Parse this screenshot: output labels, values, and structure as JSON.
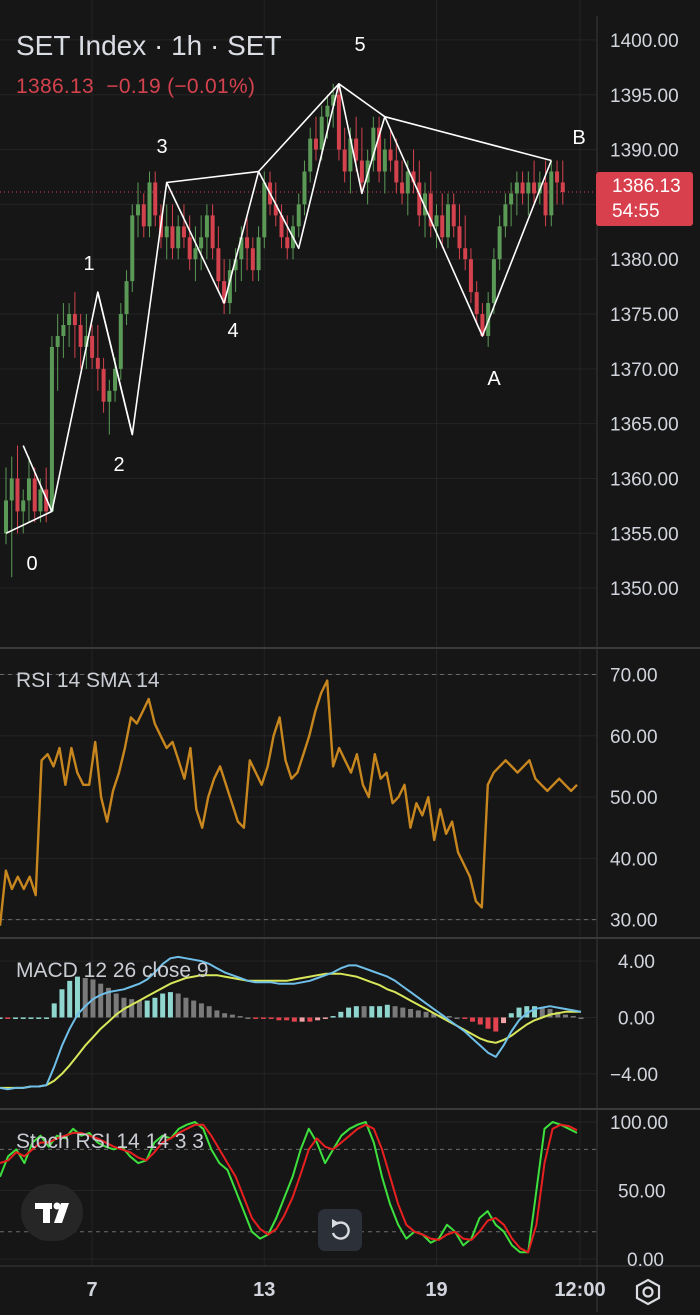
{
  "header": {
    "title": "SET Index · 1h · SET",
    "price": "1386.13",
    "change": "−0.19",
    "change_pct": "(−0.01%)"
  },
  "badge": {
    "price": "1386.13",
    "countdown": "54:55"
  },
  "indicators": {
    "rsi": "RSI 14 SMA 14",
    "macd": "MACD 12 26 close 9",
    "stoch": "Stoch RSI 14 14 3 3"
  },
  "colors": {
    "background": "#161616",
    "up": "#5b9a56",
    "down": "#d4424e",
    "rsi": "#c8861f",
    "macd": "#6fbfe8",
    "signal": "#d9e85a",
    "stoch_k": "#3ee03e",
    "stoch_d": "#e82020",
    "wave_lines": "#ffffff"
  },
  "chart_data": [
    {
      "type": "candlestick",
      "title": "SET Index · 1h · SET",
      "y_ticks": [
        "1400.00",
        "1395.00",
        "1390.00",
        "1385.00",
        "1380.00",
        "1375.00",
        "1370.00",
        "1365.00",
        "1360.00",
        "1355.00",
        "1350.00"
      ],
      "ylim": [
        1346,
        1402
      ],
      "x_ticks": [
        {
          "label": "7",
          "i": 15
        },
        {
          "label": "13",
          "i": 45
        },
        {
          "label": "19",
          "i": 75
        },
        {
          "label": "12:00",
          "i": 100
        }
      ],
      "last_price": 1386.13,
      "candles": [
        [
          1355,
          1361,
          1354,
          1358
        ],
        [
          1358,
          1362,
          1351,
          1360
        ],
        [
          1360,
          1363,
          1355,
          1357
        ],
        [
          1357,
          1359,
          1355,
          1358
        ],
        [
          1358,
          1362,
          1356,
          1360
        ],
        [
          1360,
          1361,
          1356,
          1357
        ],
        [
          1357,
          1360,
          1356,
          1359
        ],
        [
          1359,
          1361,
          1356,
          1357
        ],
        [
          1357,
          1373,
          1357,
          1372
        ],
        [
          1372,
          1375,
          1368,
          1373
        ],
        [
          1373,
          1376,
          1371,
          1374
        ],
        [
          1374,
          1376,
          1372,
          1375
        ],
        [
          1375,
          1377,
          1371,
          1374
        ],
        [
          1374,
          1375,
          1370,
          1372
        ],
        [
          1372,
          1375,
          1370,
          1373
        ],
        [
          1373,
          1374,
          1370,
          1371
        ],
        [
          1371,
          1374,
          1368,
          1370
        ],
        [
          1370,
          1371,
          1366,
          1367
        ],
        [
          1367,
          1369,
          1364,
          1368
        ],
        [
          1368,
          1371,
          1367,
          1370
        ],
        [
          1370,
          1376,
          1369,
          1375
        ],
        [
          1375,
          1379,
          1374,
          1378
        ],
        [
          1378,
          1385,
          1377,
          1384
        ],
        [
          1384,
          1387,
          1382,
          1385
        ],
        [
          1385,
          1386,
          1382,
          1383
        ],
        [
          1383,
          1388,
          1382,
          1387
        ],
        [
          1387,
          1388,
          1383,
          1384
        ],
        [
          1384,
          1385,
          1381,
          1382
        ],
        [
          1382,
          1385,
          1380,
          1383
        ],
        [
          1383,
          1385,
          1380,
          1381
        ],
        [
          1381,
          1384,
          1380,
          1383
        ],
        [
          1383,
          1385,
          1381,
          1382
        ],
        [
          1382,
          1384,
          1379,
          1380
        ],
        [
          1380,
          1383,
          1378,
          1381
        ],
        [
          1381,
          1384,
          1379,
          1382
        ],
        [
          1382,
          1385,
          1380,
          1384
        ],
        [
          1384,
          1385,
          1380,
          1381
        ],
        [
          1381,
          1383,
          1377,
          1378
        ],
        [
          1378,
          1380,
          1375,
          1376
        ],
        [
          1376,
          1380,
          1375,
          1379
        ],
        [
          1379,
          1381,
          1377,
          1380
        ],
        [
          1380,
          1383,
          1378,
          1382
        ],
        [
          1382,
          1384,
          1379,
          1381
        ],
        [
          1381,
          1382,
          1378,
          1379
        ],
        [
          1379,
          1383,
          1378,
          1382
        ],
        [
          1382,
          1388,
          1381,
          1387
        ],
        [
          1387,
          1388,
          1384,
          1385
        ],
        [
          1385,
          1387,
          1383,
          1384
        ],
        [
          1384,
          1385,
          1381,
          1382
        ],
        [
          1382,
          1384,
          1380,
          1381
        ],
        [
          1381,
          1384,
          1380,
          1383
        ],
        [
          1383,
          1386,
          1382,
          1385
        ],
        [
          1385,
          1389,
          1384,
          1388
        ],
        [
          1388,
          1392,
          1387,
          1391
        ],
        [
          1391,
          1393,
          1389,
          1390
        ],
        [
          1390,
          1394,
          1389,
          1393
        ],
        [
          1393,
          1395,
          1391,
          1394
        ],
        [
          1394,
          1396,
          1392,
          1395
        ],
        [
          1395,
          1396,
          1389,
          1390
        ],
        [
          1390,
          1392,
          1387,
          1388
        ],
        [
          1388,
          1392,
          1386,
          1391
        ],
        [
          1391,
          1393,
          1388,
          1389
        ],
        [
          1389,
          1392,
          1386,
          1387
        ],
        [
          1387,
          1390,
          1385,
          1389
        ],
        [
          1389,
          1393,
          1388,
          1392
        ],
        [
          1392,
          1393,
          1387,
          1388
        ],
        [
          1388,
          1391,
          1386,
          1390
        ],
        [
          1390,
          1392,
          1388,
          1389
        ],
        [
          1389,
          1391,
          1386,
          1387
        ],
        [
          1387,
          1389,
          1385,
          1386
        ],
        [
          1386,
          1389,
          1384,
          1388
        ],
        [
          1388,
          1390,
          1386,
          1387
        ],
        [
          1387,
          1389,
          1383,
          1384
        ],
        [
          1384,
          1387,
          1382,
          1386
        ],
        [
          1386,
          1388,
          1382,
          1383
        ],
        [
          1383,
          1385,
          1381,
          1384
        ],
        [
          1384,
          1386,
          1381,
          1382
        ],
        [
          1382,
          1386,
          1381,
          1385
        ],
        [
          1385,
          1386,
          1382,
          1383
        ],
        [
          1383,
          1385,
          1380,
          1381
        ],
        [
          1381,
          1384,
          1379,
          1380
        ],
        [
          1380,
          1381,
          1376,
          1377
        ],
        [
          1377,
          1378,
          1374,
          1375
        ],
        [
          1375,
          1376,
          1373,
          1373
        ],
        [
          1373,
          1377,
          1372,
          1376
        ],
        [
          1376,
          1381,
          1375,
          1380
        ],
        [
          1380,
          1384,
          1379,
          1383
        ],
        [
          1383,
          1386,
          1382,
          1385
        ],
        [
          1385,
          1387,
          1383,
          1386
        ],
        [
          1386,
          1388,
          1384,
          1387
        ],
        [
          1387,
          1388,
          1385,
          1386
        ],
        [
          1386,
          1388,
          1384,
          1387
        ],
        [
          1387,
          1389,
          1385,
          1386
        ],
        [
          1386,
          1388,
          1385,
          1387
        ],
        [
          1387,
          1389,
          1383,
          1384
        ],
        [
          1384,
          1389,
          1383,
          1388
        ],
        [
          1388,
          1389,
          1385,
          1387
        ],
        [
          1387,
          1389,
          1385,
          1386.13
        ]
      ],
      "wave_labels": [
        "0",
        "1",
        "2",
        "3",
        "4",
        "5",
        "A",
        "B"
      ],
      "wave_lines": [
        {
          "points": [
            [
              0,
              1355
            ],
            [
              8,
              1357
            ],
            [
              16,
              1377
            ],
            [
              22,
              1364
            ],
            [
              28,
              1387
            ],
            [
              38,
              1376
            ],
            [
              44,
              1388
            ],
            [
              51,
              1381
            ],
            [
              58,
              1396
            ],
            [
              62,
              1386
            ],
            [
              66,
              1393
            ],
            [
              83,
              1373
            ],
            [
              95,
              1389
            ]
          ]
        },
        {
          "points": [
            [
              3,
              1363
            ],
            [
              8,
              1357
            ]
          ]
        },
        {
          "points": [
            [
              22,
              1364
            ],
            [
              16,
              1377
            ]
          ]
        },
        {
          "points": [
            [
              28,
              1387
            ],
            [
              44,
              1388
            ],
            [
              58,
              1396
            ],
            [
              66,
              1393
            ],
            [
              95,
              1389
            ]
          ]
        }
      ]
    },
    {
      "type": "line",
      "title": "RSI 14 SMA 14",
      "y_ticks": [
        "70.00",
        "60.00",
        "50.00",
        "40.00",
        "30.00"
      ],
      "ylim": [
        27,
        74
      ],
      "bands": [
        30,
        70
      ],
      "x_count": 98,
      "series": [
        {
          "values": [
            29,
            38,
            35,
            37,
            35,
            37,
            34,
            56,
            57,
            55,
            58,
            52,
            58,
            54,
            52,
            52,
            59,
            50,
            46,
            51,
            54,
            58,
            63,
            62,
            64,
            66,
            62,
            60,
            58,
            59,
            56,
            53,
            58,
            48,
            45,
            50,
            53,
            55,
            52,
            49,
            46,
            45,
            56,
            54,
            52,
            55,
            60,
            63,
            56,
            53,
            54,
            57,
            60,
            64,
            67,
            69,
            55,
            58,
            56,
            54,
            57,
            52,
            50,
            57,
            53,
            54,
            49,
            50,
            52,
            45,
            49,
            47,
            50,
            43,
            48,
            44,
            46,
            41,
            39,
            37,
            33,
            32,
            52,
            54,
            55,
            56,
            55,
            54,
            55,
            56,
            53,
            52,
            51,
            52,
            53,
            52,
            51,
            52
          ]
        }
      ]
    },
    {
      "type": "macd",
      "title": "MACD 12 26 close 9",
      "y_ticks": [
        "4.00",
        "0.00",
        "−4.00"
      ],
      "ylim": [
        -6.5,
        5.5
      ],
      "series": [
        {
          "name": "MACD",
          "values": [
            -5.0,
            -5.1,
            -5.0,
            -5.0,
            -4.9,
            -4.9,
            -4.8,
            -3.5,
            -2.0,
            -0.8,
            0.2,
            0.8,
            1.3,
            1.6,
            1.8,
            1.9,
            2.0,
            2.2,
            2.4,
            2.7,
            3.2,
            3.8,
            4.2,
            4.3,
            4.2,
            4.1,
            4.0,
            3.8,
            3.5,
            3.2,
            3.0,
            2.8,
            2.6,
            2.5,
            2.5,
            2.5,
            2.4,
            2.4,
            2.4,
            2.5,
            2.6,
            2.8,
            3.0,
            3.2,
            3.5,
            3.7,
            3.7,
            3.5,
            3.3,
            3.1,
            2.9,
            2.6,
            2.2,
            1.8,
            1.4,
            1.0,
            0.6,
            0.2,
            -0.2,
            -0.6,
            -1.0,
            -1.5,
            -2.0,
            -2.5,
            -2.8,
            -2.0,
            -1.0,
            -0.2,
            0.3,
            0.6,
            0.7,
            0.8,
            0.7,
            0.6,
            0.5,
            0.4
          ]
        },
        {
          "name": "Signal",
          "values": [
            -5.0,
            -5.0,
            -5.0,
            -5.0,
            -4.9,
            -4.9,
            -4.8,
            -4.5,
            -4.0,
            -3.4,
            -2.7,
            -2.0,
            -1.4,
            -0.8,
            -0.3,
            0.2,
            0.6,
            0.9,
            1.2,
            1.5,
            1.8,
            2.1,
            2.4,
            2.6,
            2.8,
            2.9,
            3.0,
            3.0,
            3.0,
            2.9,
            2.8,
            2.7,
            2.6,
            2.6,
            2.6,
            2.6,
            2.6,
            2.6,
            2.7,
            2.8,
            2.9,
            3.0,
            3.1,
            3.1,
            3.1,
            3.0,
            2.9,
            2.7,
            2.5,
            2.3,
            2.0,
            1.8,
            1.5,
            1.2,
            0.9,
            0.6,
            0.3,
            0.0,
            -0.3,
            -0.6,
            -0.9,
            -1.2,
            -1.5,
            -1.7,
            -1.8,
            -1.6,
            -1.3,
            -0.9,
            -0.5,
            -0.2,
            0.0,
            0.2,
            0.3,
            0.4,
            0.4,
            0.4
          ]
        }
      ]
    },
    {
      "type": "line",
      "title": "Stoch RSI 14 14 3 3",
      "y_ticks": [
        "100.00",
        "50.00",
        "0.00"
      ],
      "ylim": [
        -5,
        108
      ],
      "bands": [
        20,
        80
      ],
      "series": [
        {
          "name": "K",
          "values": [
            60,
            75,
            80,
            70,
            85,
            90,
            82,
            90,
            88,
            95,
            90,
            92,
            85,
            82,
            80,
            82,
            75,
            70,
            72,
            85,
            90,
            88,
            95,
            98,
            100,
            95,
            80,
            70,
            65,
            50,
            35,
            20,
            15,
            18,
            30,
            45,
            60,
            80,
            95,
            85,
            70,
            80,
            90,
            95,
            98,
            100,
            85,
            60,
            40,
            25,
            15,
            20,
            18,
            12,
            15,
            25,
            20,
            10,
            15,
            30,
            35,
            25,
            20,
            10,
            5,
            5,
            50,
            95,
            100,
            98,
            95,
            92
          ]
        },
        {
          "name": "D",
          "values": [
            70,
            72,
            78,
            75,
            80,
            85,
            85,
            88,
            90,
            92,
            92,
            90,
            88,
            85,
            82,
            80,
            78,
            74,
            72,
            78,
            85,
            88,
            92,
            95,
            98,
            98,
            90,
            80,
            70,
            60,
            45,
            30,
            22,
            18,
            22,
            32,
            45,
            62,
            80,
            88,
            82,
            80,
            85,
            90,
            95,
            98,
            95,
            80,
            60,
            40,
            25,
            20,
            18,
            15,
            14,
            18,
            20,
            15,
            14,
            20,
            28,
            30,
            25,
            15,
            8,
            5,
            25,
            70,
            95,
            98,
            97,
            94
          ]
        }
      ]
    }
  ]
}
